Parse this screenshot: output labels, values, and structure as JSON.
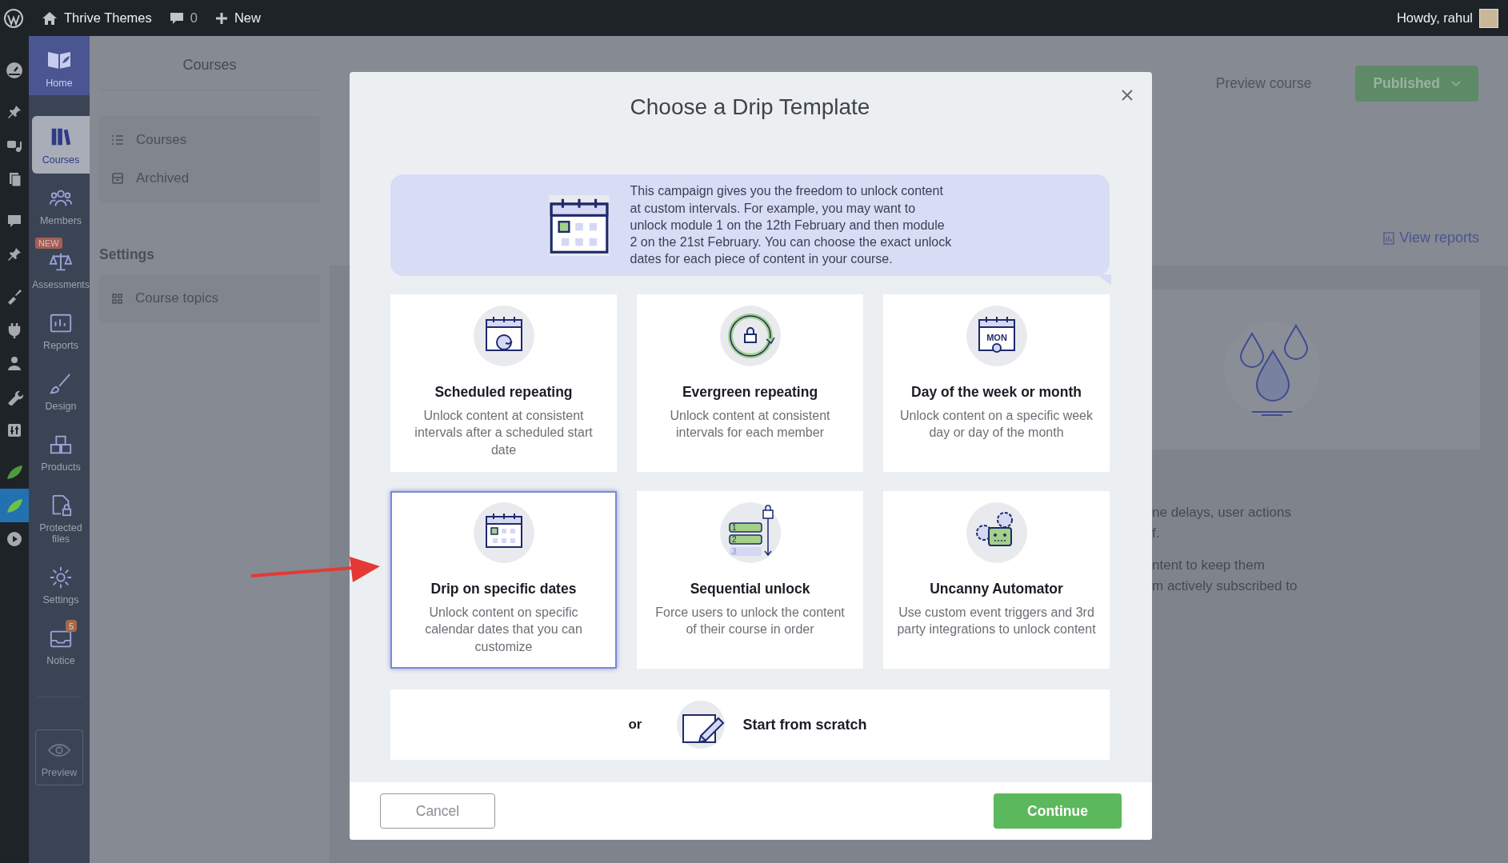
{
  "top_bar": {
    "site_name": "Thrive Themes",
    "comments_count": "0",
    "new_label": "New",
    "greeting": "Howdy, rahul"
  },
  "wp_menu": [
    {
      "selected": false
    },
    {
      "selected": false
    },
    {
      "selected": false
    },
    {
      "selected": false
    },
    {
      "selected": false
    },
    {
      "selected": false
    },
    {
      "selected": false
    },
    {
      "selected": false
    },
    {
      "selected": false
    },
    {
      "selected": false
    },
    {
      "selected": false
    },
    {
      "selected": false
    },
    {
      "selected": true
    },
    {
      "selected": false
    }
  ],
  "app_sidebar": {
    "items": [
      {
        "label": "Home",
        "kind": "home",
        "selected": false,
        "disabled": false
      },
      {
        "label": "Courses",
        "kind": "item",
        "selected": true,
        "disabled": false
      },
      {
        "label": "Members",
        "kind": "item",
        "selected": false,
        "disabled": false
      },
      {
        "label": "Assessments",
        "kind": "item",
        "selected": false,
        "disabled": false,
        "badge": "NEW"
      },
      {
        "label": "Reports",
        "kind": "item",
        "selected": false,
        "disabled": false
      },
      {
        "label": "Design",
        "kind": "item",
        "selected": false,
        "disabled": false
      },
      {
        "label": "Products",
        "kind": "item",
        "selected": false,
        "disabled": false
      },
      {
        "label": "Protected files",
        "kind": "item",
        "selected": false,
        "disabled": false
      },
      {
        "label": "Settings",
        "kind": "item",
        "selected": false,
        "disabled": false
      },
      {
        "label": "Notice",
        "kind": "item",
        "selected": false,
        "disabled": false,
        "count": "5"
      },
      {
        "label": "Preview",
        "kind": "preview",
        "selected": false,
        "disabled": true
      }
    ]
  },
  "course_nav": {
    "title": "Courses",
    "items": [
      {
        "label": "Courses"
      },
      {
        "label": "Archived"
      }
    ],
    "settings_heading": "Settings",
    "settings_items": [
      {
        "label": "Course topics"
      }
    ]
  },
  "main": {
    "preview_link": "Preview course",
    "status_button": "Published",
    "reports_link": "View reports",
    "text_fragments": [
      "ne delays, user actions",
      "f.",
      "ntent to keep them",
      "m actively subscribed to"
    ]
  },
  "dialog": {
    "title": "Choose a Drip Template",
    "info": "This campaign gives you the freedom to unlock content at custom intervals. For example, you may want to unlock module 1 on the 12th February and then module 2 on the 21st February. You can choose the exact unlock dates for each piece of content in your course.",
    "templates": [
      {
        "title": "Scheduled repeating",
        "description": "Unlock content at consistent intervals after a scheduled start date",
        "selected": false
      },
      {
        "title": "Evergreen repeating",
        "description": "Unlock content at consistent intervals for each member",
        "selected": false
      },
      {
        "title": "Day of the week or month",
        "description": "Unlock content on a specific week day or day of the month",
        "selected": false,
        "icon_labels": [
          "MON"
        ]
      },
      {
        "title": "Drip on specific dates",
        "description": "Unlock content on specific calendar dates that you can customize",
        "selected": true
      },
      {
        "title": "Sequential unlock",
        "description": "Force users to unlock the content of their course in order",
        "selected": false,
        "icon_labels": [
          "1",
          "2",
          "3"
        ]
      },
      {
        "title": "Uncanny Automator",
        "description": "Use custom event triggers and 3rd party integrations to unlock content",
        "selected": false
      }
    ],
    "or_label": "or",
    "scratch_label": "Start from scratch",
    "cancel": "Cancel",
    "continue": "Continue"
  }
}
